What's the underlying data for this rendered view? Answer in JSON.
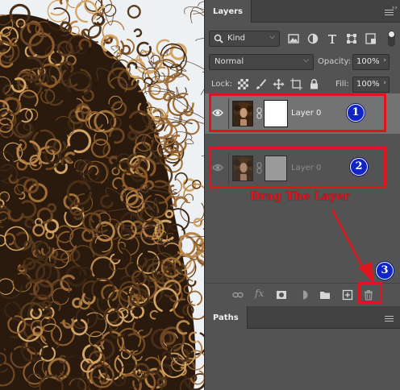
{
  "layers_panel": {
    "tab_label": "Layers",
    "filter": {
      "kind_value": "Kind",
      "icons": [
        "image-filter-icon",
        "adjustment-filter-icon",
        "type-filter-icon",
        "shape-filter-icon",
        "smart-object-filter-icon"
      ]
    },
    "blend_mode": "Normal",
    "opacity_label": "Opacity:",
    "opacity_value": "100%",
    "lock_label": "Lock:",
    "fill_label": "Fill:",
    "fill_value": "100%",
    "layers": [
      {
        "name": "Layer 0",
        "visible": true,
        "selected": true
      },
      {
        "name": "Layer 0",
        "visible": true,
        "selected": false
      }
    ],
    "bottom_icons": [
      "link-layers-icon",
      "fx-icon",
      "add-mask-icon",
      "adjustment-layer-icon",
      "new-group-icon",
      "new-layer-icon",
      "trash-icon"
    ]
  },
  "paths_panel": {
    "tab_label": "Paths"
  },
  "annotations": {
    "badge_1": "1",
    "badge_2": "2",
    "badge_3": "3",
    "instruction": "Drag The Layer",
    "accent_color": "#e0141c",
    "badge_color": "#1124c8"
  }
}
